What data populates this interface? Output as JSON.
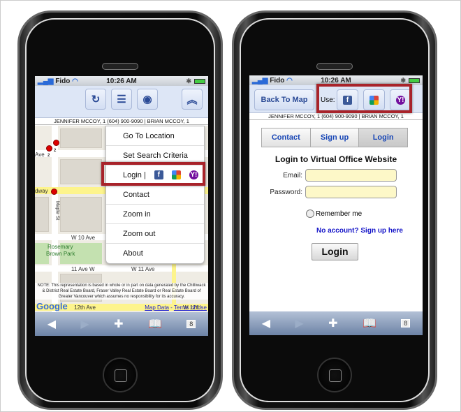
{
  "status": {
    "carrier": "Fido",
    "time": "10:26 AM"
  },
  "names_strip": "JENNIFER MCCOY, 1 (604) 900-9090 | BRIAN MCCOY, 1",
  "left": {
    "toolbar_icons": [
      "refresh-icon",
      "list-icon",
      "wifi-icon",
      "chevron-up-icon"
    ],
    "menu": [
      "Go To Location",
      "Set Search Criteria",
      "Login |",
      "Contact",
      "Zoom in",
      "Zoom out",
      "About"
    ],
    "map_labels": [
      "Ave",
      "dway",
      "Maple St",
      "W 10 Ave",
      "Rosemary",
      "Brown Park",
      "11 Ave W",
      "W 11 Ave",
      "12th Ave",
      "W 12th"
    ],
    "pin_labels": [
      "2",
      "2"
    ],
    "note": "NOTE: This representation is based in whole or in part on data generated by the Chilliwack & District Real Estate Board, Fraser Valley Real Estate Board or Real Estate Board of Greater Vancouver which assumes no responsibility for its accuracy.",
    "google": "Google",
    "map_data": "Map Data",
    "terms": "Terms of Use",
    "tab_count": "8"
  },
  "right": {
    "back": "Back To Map",
    "use": "Use:",
    "tabs": [
      "Contact",
      "Sign up",
      "Login"
    ],
    "title": "Login to Virtual Office Website",
    "email_label": "Email:",
    "password_label": "Password:",
    "remember": "Remember me",
    "signup_link": "No account? Sign up here",
    "login_button": "Login",
    "tab_count": "8"
  },
  "colors": {
    "highlight": "#a8232a",
    "link": "#1414c8",
    "input_bg": "#fdf8c8",
    "toolbar": "#dde6f6"
  }
}
